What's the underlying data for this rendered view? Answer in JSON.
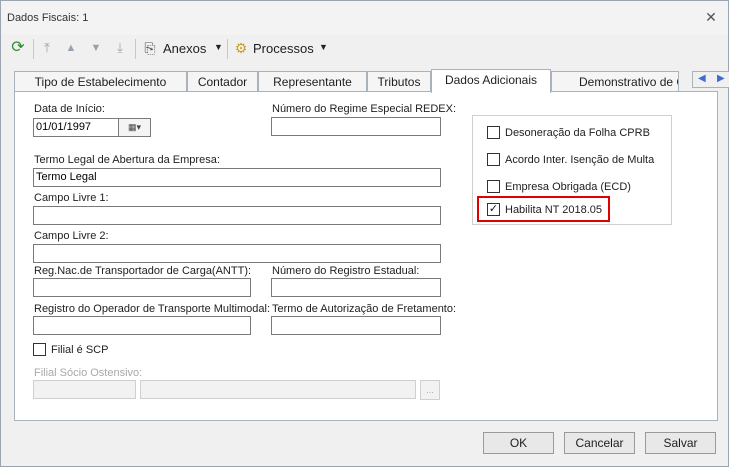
{
  "window": {
    "title": "Dados Fiscais: 1",
    "close_glyph": "✕"
  },
  "toolbar": {
    "refresh_icon": "refresh-icon",
    "anexos_label": "Anexos",
    "processos_label": "Processos"
  },
  "tabs": [
    {
      "label": "Tipo de Estabelecimento"
    },
    {
      "label": "Contador"
    },
    {
      "label": "Representante"
    },
    {
      "label": "Tributos"
    },
    {
      "label": "Dados Adicionais"
    },
    {
      "label": "Demonstrativo de C"
    }
  ],
  "active_tab": "Dados Adicionais",
  "form": {
    "data_inicio_label": "Data de Início:",
    "data_inicio_value": "01/01/1997",
    "redex_label": "Número do Regime Especial REDEX:",
    "redex_value": "",
    "termo_legal_label": "Termo Legal de Abertura da Empresa:",
    "termo_legal_value": "Termo Legal",
    "campo_livre1_label": "Campo Livre 1:",
    "campo_livre1_value": "",
    "campo_livre2_label": "Campo Livre 2:",
    "campo_livre2_value": "",
    "antt_label": "Reg.Nac.de Transportador de Carga(ANTT):",
    "antt_value": "",
    "registro_estadual_label": "Número do Registro Estadual:",
    "registro_estadual_value": "",
    "multimodal_label": "Registro do Operador de Transporte Multimodal:",
    "multimodal_value": "",
    "fretamento_label": "Termo de Autorização de Fretamento:",
    "fretamento_value": "",
    "filial_scp_label": "Filial é SCP",
    "filial_scp_checked": false,
    "filial_socio_label": "Filial Sócio Ostensivo:"
  },
  "options": [
    {
      "label": "Desoneração da Folha CPRB",
      "checked": false
    },
    {
      "label": "Acordo Inter. Isenção de Multa",
      "checked": false
    },
    {
      "label": "Empresa Obrigada (ECD)",
      "checked": false
    },
    {
      "label": "Habilita NT 2018.05",
      "checked": true
    }
  ],
  "buttons": {
    "ok": "OK",
    "cancel": "Cancelar",
    "save": "Salvar"
  },
  "colors": {
    "highlight": "#e00000",
    "tab_arrow": "#3b6ed0"
  }
}
